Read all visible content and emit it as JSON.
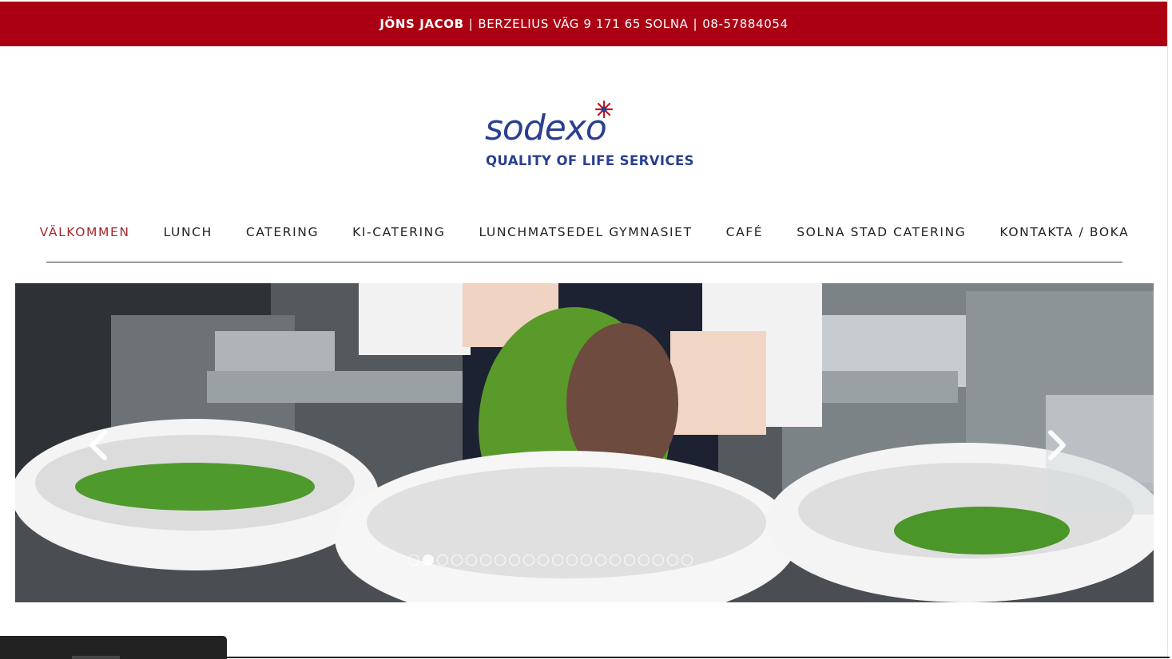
{
  "topbar": {
    "name": "JÖNS JACOB",
    "address": "BERZELIUS VÄG 9 171 65 SOLNA",
    "phone": "08-57884054",
    "separator": "|",
    "background": "#ab0014"
  },
  "logo": {
    "wordmark": "sodexo",
    "tagline": "QUALITY OF LIFE SERVICES",
    "color": "#2a3f8f",
    "star_color": "#d0101e"
  },
  "nav": {
    "items": [
      {
        "label": "VÄLKOMMEN",
        "active": true
      },
      {
        "label": "LUNCH",
        "active": false
      },
      {
        "label": "CATERING",
        "active": false
      },
      {
        "label": "KI-CATERING",
        "active": false
      },
      {
        "label": "LUNCHMATSEDEL GYMNASIET",
        "active": false
      },
      {
        "label": "CAFÉ",
        "active": false
      },
      {
        "label": "SOLNA STAD CATERING",
        "active": false
      },
      {
        "label": "KONTAKTA / BOKA",
        "active": false
      }
    ],
    "active_color": "#a3272c"
  },
  "slider": {
    "prev_icon": "chevron-left-icon",
    "next_icon": "chevron-right-icon",
    "slide_count": 20,
    "active_slide": 1
  }
}
